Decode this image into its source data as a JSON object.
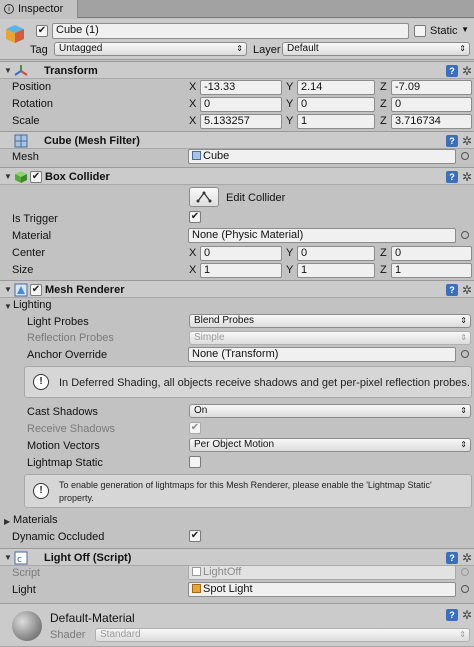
{
  "tab": {
    "title": "Inspector"
  },
  "object": {
    "name": "Cube (1)",
    "static_label": "Static",
    "tag_label": "Tag",
    "tag_value": "Untagged",
    "layer_label": "Layer",
    "layer_value": "Default"
  },
  "transform": {
    "title": "Transform",
    "rows": [
      {
        "label": "Position",
        "x": "-13.33",
        "y": "2.14",
        "z": "-7.09"
      },
      {
        "label": "Rotation",
        "x": "0",
        "y": "0",
        "z": "0"
      },
      {
        "label": "Scale",
        "x": "5.133257",
        "y": "1",
        "z": "3.716734"
      }
    ]
  },
  "axis": {
    "x": "X",
    "y": "Y",
    "z": "Z"
  },
  "mesh_filter": {
    "title": "Cube (Mesh Filter)",
    "mesh_label": "Mesh",
    "mesh_value": "Cube"
  },
  "box_collider": {
    "title": "Box Collider",
    "edit_label": "Edit Collider",
    "is_trigger_label": "Is Trigger",
    "material_label": "Material",
    "material_value": "None (Physic Material)",
    "center_label": "Center",
    "center": {
      "x": "0",
      "y": "0",
      "z": "0"
    },
    "size_label": "Size",
    "size": {
      "x": "1",
      "y": "1",
      "z": "1"
    }
  },
  "mesh_renderer": {
    "title": "Mesh Renderer",
    "lighting_label": "Lighting",
    "light_probes_label": "Light Probes",
    "light_probes_value": "Blend Probes",
    "reflection_probes_label": "Reflection Probes",
    "reflection_probes_value": "Simple",
    "anchor_override_label": "Anchor Override",
    "anchor_override_value": "None (Transform)",
    "info1": "In Deferred Shading, all objects receive shadows and get per-pixel reflection probes.",
    "cast_shadows_label": "Cast Shadows",
    "cast_shadows_value": "On",
    "receive_shadows_label": "Receive Shadows",
    "motion_vectors_label": "Motion Vectors",
    "motion_vectors_value": "Per Object Motion",
    "lightmap_static_label": "Lightmap Static",
    "info2_line1": "To enable generation of lightmaps for this Mesh Renderer, please enable the 'Lightmap Static'",
    "info2_line2": "property.",
    "materials_label": "Materials",
    "dynamic_occluded_label": "Dynamic Occluded"
  },
  "light_off": {
    "title": "Light Off (Script)",
    "script_label": "Script",
    "script_value": "LightOff",
    "light_label": "Light",
    "light_value": "Spot Light"
  },
  "material": {
    "name": "Default-Material",
    "shader_label": "Shader",
    "shader_value": "Standard"
  },
  "colors": {
    "background": "#c2c2c2",
    "help_blue": "#3c6fb5"
  }
}
